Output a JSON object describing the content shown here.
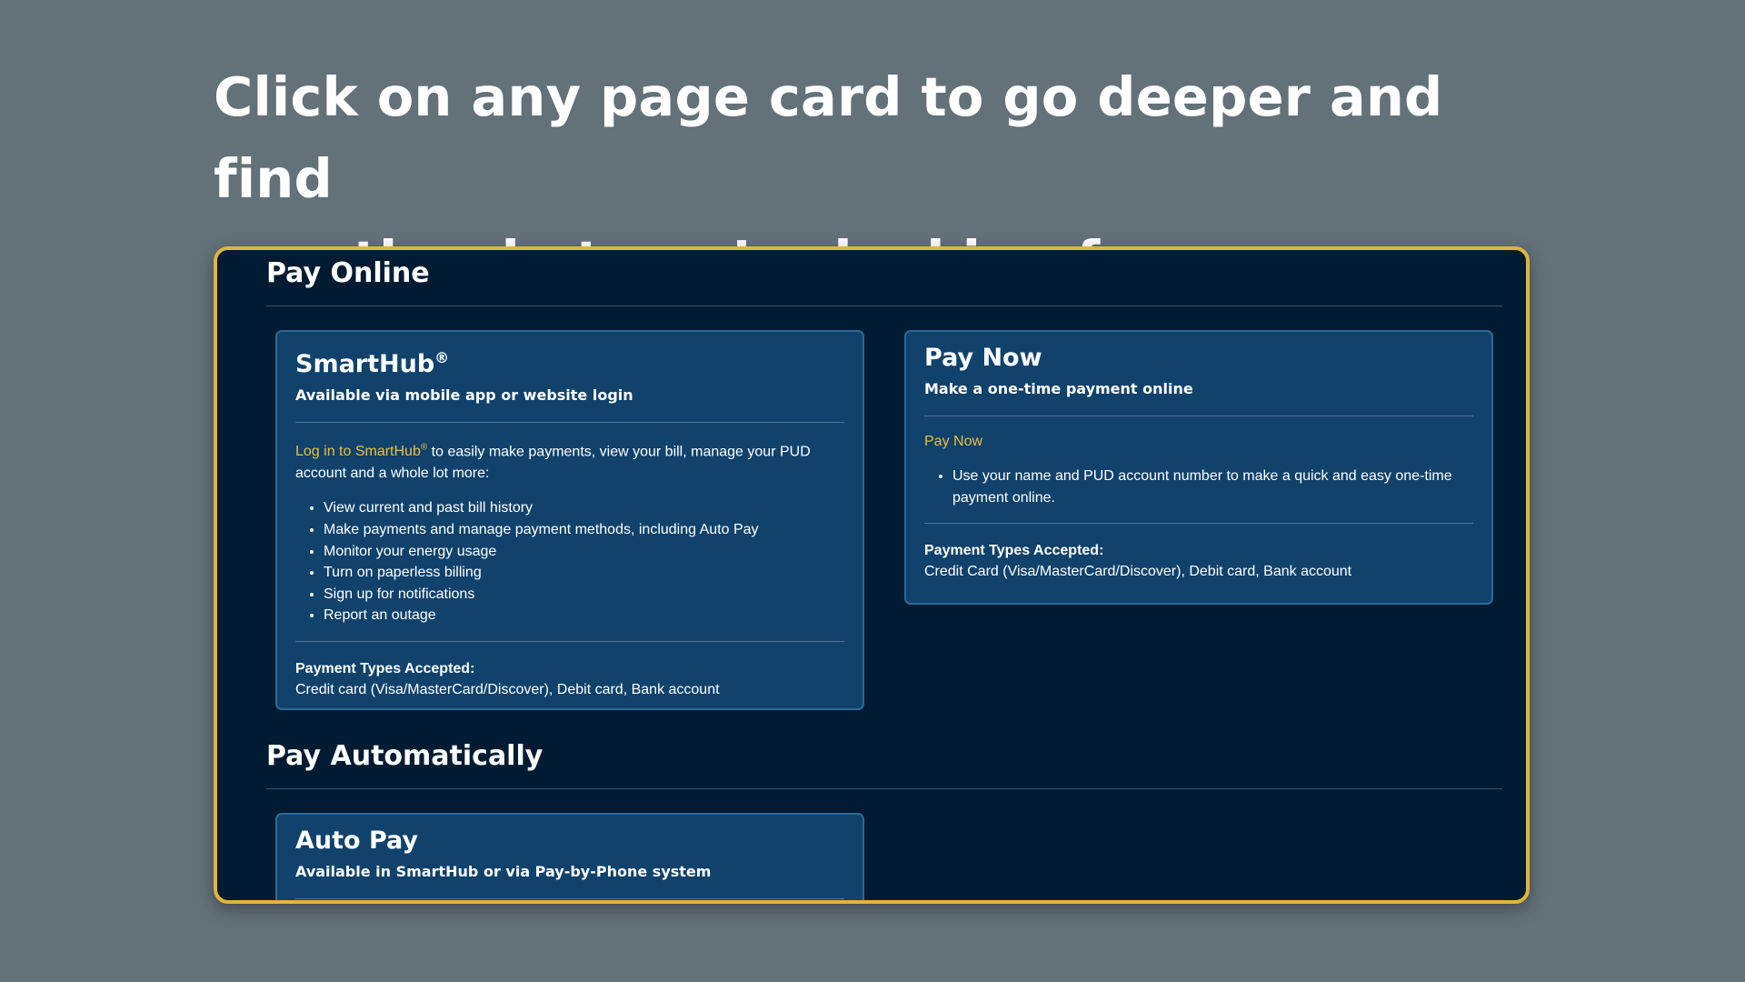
{
  "headline": {
    "line1": "Click on any page card to go deeper and find",
    "line2": "exactly what you’re looking for."
  },
  "sections": {
    "pay_online": {
      "title": "Pay Online"
    },
    "pay_automatically": {
      "title": "Pay Automatically"
    }
  },
  "cards": {
    "smarthub": {
      "title": "SmartHub",
      "title_mark": "®",
      "subtitle": "Available via mobile app or website login",
      "link_text": "Log in to SmartHub",
      "link_mark": "®",
      "body_text": " to easily make payments, view your bill, manage your PUD account and a whole lot more:",
      "bullets": [
        "View current and past bill history",
        "Make payments and manage payment methods, including Auto Pay",
        "Monitor your energy usage",
        "Turn on paperless billing",
        "Sign up for notifications",
        "Report an outage"
      ],
      "payment_label": "Payment Types Accepted:",
      "payment_value": "Credit card (Visa/MasterCard/Discover), Debit card, Bank account"
    },
    "pay_now": {
      "title": "Pay Now",
      "subtitle": "Make a one-time payment online",
      "link_text": "Pay Now",
      "bullets": [
        "Use your name and PUD account number to make a quick and easy one-time payment online."
      ],
      "payment_label": "Payment Types Accepted:",
      "payment_value": "Credit Card (Visa/MasterCard/Discover), Debit card, Bank account"
    },
    "auto_pay": {
      "title": "Auto Pay",
      "subtitle": "Available in SmartHub or via Pay-by-Phone system"
    }
  },
  "colors": {
    "page_background": "#637179",
    "frame_border": "#e1b43b",
    "frame_background": "#011c32",
    "card_background": "#10426c",
    "link": "#f0bd3e"
  }
}
